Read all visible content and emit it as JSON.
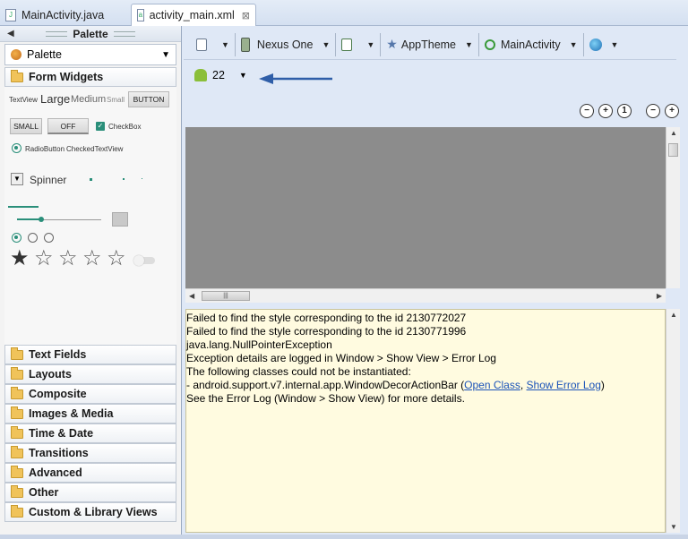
{
  "tabs": [
    {
      "label": "MainActivity.java",
      "active": false
    },
    {
      "label": "activity_main.xml",
      "active": true,
      "close": "⊠"
    }
  ],
  "palette": {
    "title": "Palette",
    "header": "Palette",
    "form_widgets": "Form Widgets",
    "widgets": {
      "textview": "TextView",
      "large": "Large",
      "medium": "Medium",
      "small": "Small",
      "button": "BUTTON",
      "small_button": "SMALL",
      "toggle_off": "OFF",
      "checkbox": "CheckBox",
      "radiobutton": "RadioButton",
      "checkedtextview": "CheckedTextView",
      "spinner": "Spinner"
    },
    "sections": [
      "Text Fields",
      "Layouts",
      "Composite",
      "Images & Media",
      "Time & Date",
      "Transitions",
      "Advanced",
      "Other",
      "Custom & Library Views"
    ]
  },
  "toolbar": {
    "device": "Nexus One",
    "theme": "AppTheme",
    "activity": "MainActivity",
    "api_level": "22"
  },
  "zoom": [
    "−",
    "+",
    "1",
    "−",
    "+"
  ],
  "errors": {
    "lines": [
      "Failed to find the style corresponding to the id 2130772027",
      "Failed to find the style corresponding to the id 2130771996",
      "java.lang.NullPointerException",
      "Exception details are logged in Window > Show View > Error Log",
      "The following classes could not be instantiated:"
    ],
    "class_line_prefix": "- android.support.v7.internal.app.WindowDecorActionBar (",
    "open_class": "Open Class",
    "sep": ", ",
    "show_error_log": "Show Error Log",
    "class_line_suffix": ")",
    "last_line": "See the Error Log (Window > Show View) for more details."
  },
  "colors": {
    "accent_widget": "#2a8f7a",
    "arrow": "#2f5ea8",
    "error_bg": "#fffbe0"
  }
}
